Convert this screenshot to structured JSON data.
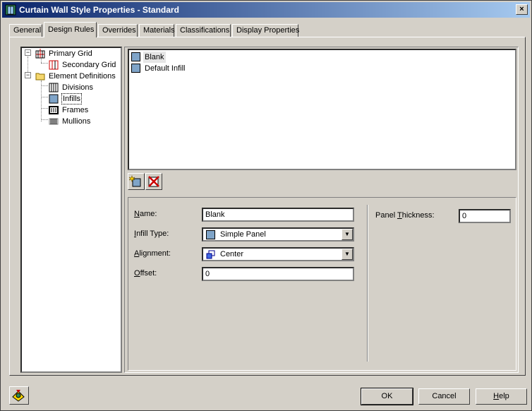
{
  "window": {
    "title": "Curtain Wall Style Properties - Standard",
    "close_label": "×"
  },
  "tabs": [
    {
      "label": "General"
    },
    {
      "label": "Design Rules",
      "active": true
    },
    {
      "label": "Overrides"
    },
    {
      "label": "Materials"
    },
    {
      "label": "Classifications"
    },
    {
      "label": "Display Properties"
    }
  ],
  "tree": {
    "items": [
      {
        "label": "Primary Grid",
        "icon": "grid-icon",
        "expander": "−"
      },
      {
        "label": "Secondary Grid",
        "icon": "secondary-grid-icon"
      },
      {
        "label": "Element Definitions",
        "icon": "folder-icon",
        "expander": "−"
      },
      {
        "label": "Divisions",
        "icon": "divisions-icon"
      },
      {
        "label": "Infills",
        "icon": "infill-icon",
        "selected": true
      },
      {
        "label": "Frames",
        "icon": "frames-icon"
      },
      {
        "label": "Mullions",
        "icon": "mullions-icon"
      }
    ]
  },
  "list": {
    "items": [
      {
        "label": "Blank",
        "icon": "infill-icon"
      },
      {
        "label": "Default Infill",
        "icon": "infill-icon"
      }
    ]
  },
  "toolbar": {
    "new_icon": "new-infill-icon",
    "delete_icon": "delete-icon"
  },
  "props": {
    "name": {
      "label_u": "N",
      "label_rest": "ame:",
      "value": "Blank"
    },
    "infill_type": {
      "label_u": "I",
      "label_rest": "nfill Type:",
      "value": "Simple Panel"
    },
    "alignment": {
      "label_u": "A",
      "label_rest": "lignment:",
      "value": "Center"
    },
    "offset": {
      "label_u": "O",
      "label_rest": "ffset:",
      "value": "0"
    },
    "panel_thickness": {
      "label_pre": "Panel ",
      "label_u": "T",
      "label_rest": "hickness:",
      "value": "0"
    }
  },
  "buttons": {
    "ok": "OK",
    "cancel": "Cancel",
    "help_u": "H",
    "help_rest": "elp"
  },
  "colors": {
    "title_start": "#0a246a",
    "title_end": "#a6caf0",
    "face": "#d4d0c8",
    "infill_blue": "#7fa4c8"
  }
}
